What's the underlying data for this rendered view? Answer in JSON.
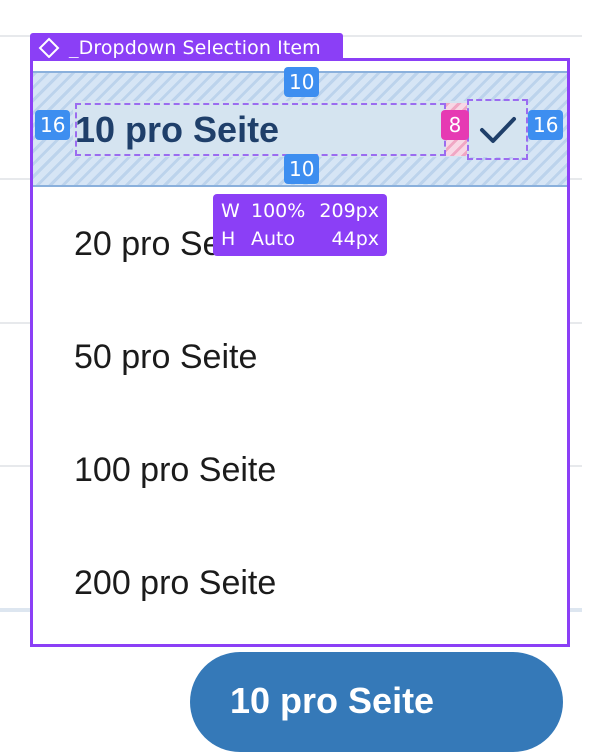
{
  "component": {
    "name": "_Dropdown Selection Item",
    "icon": "component-diamond-icon"
  },
  "selected_item": {
    "label": "10 pro Seite",
    "check_icon": "checkmark-icon"
  },
  "spacing": {
    "padding_top": "10",
    "padding_bottom": "10",
    "padding_left": "16",
    "padding_right": "16",
    "gap": "8"
  },
  "dimensions": {
    "w_key": "W",
    "w_mode": "100%",
    "w_value": "209px",
    "h_key": "H",
    "h_mode": "Auto",
    "h_value": "44px"
  },
  "options": [
    {
      "label": "20 pro Seite"
    },
    {
      "label": "50 pro Seite"
    },
    {
      "label": "100 pro Seite"
    },
    {
      "label": "200 pro Seite"
    }
  ],
  "trigger_button": {
    "label": "10 pro Seite"
  },
  "colors": {
    "selection": "#8b3ff6",
    "spacing_badge": "#3d8ef0",
    "gap_badge": "#e63ab3",
    "selected_text": "#1f3f6a",
    "button": "#3579b8"
  }
}
